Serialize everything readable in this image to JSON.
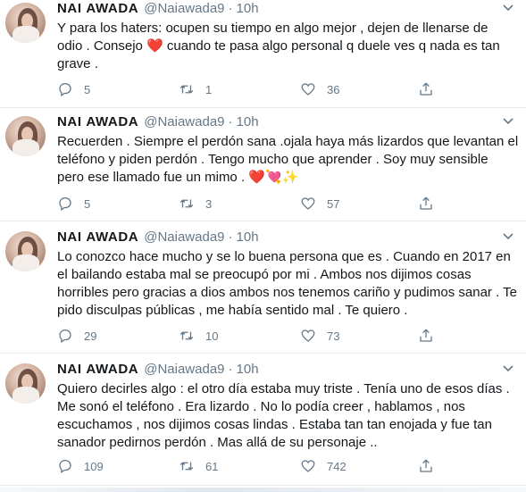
{
  "tweets": [
    {
      "name": "NΑΙ AWADA",
      "handle": "@Naiawada9",
      "time": "10h",
      "lines": [
        "Y para los haters: ocupen su tiempo en algo mejor , dejen de llenarse de",
        "odio . Consejo ❤️ cuando te pasa algo personal q duele ves q nada es tan",
        "grave ."
      ],
      "replies": "5",
      "retweets": "1",
      "likes": "36"
    },
    {
      "name": "NΑΙ AWADA",
      "handle": "@Naiawada9",
      "time": "10h",
      "lines": [
        "Recuerden . Siempre el perdón sana .ojala haya más lizardos que levantan el",
        "teléfono y piden perdón . Tengo mucho que aprender . Soy muy sensible",
        "pero ese llamado fue un mimo . ❤️💘✨"
      ],
      "replies": "5",
      "retweets": "3",
      "likes": "57"
    },
    {
      "name": "NΑΙ AWADA",
      "handle": "@Naiawada9",
      "time": "10h",
      "lines": [
        "Lo conozco hace mucho y se lo buena persona que es . Cuando en 2017 en",
        "el bailando estaba mal se preocupó por mi . Ambos nos dijimos cosas",
        "horribles pero gracias a dios ambos nos tenemos cariño y pudimos sanar . Te",
        "pido disculpas públicas , me había sentido mal . Te quiero ."
      ],
      "replies": "29",
      "retweets": "10",
      "likes": "73"
    },
    {
      "name": "NΑΙ AWADA",
      "handle": "@Naiawada9",
      "time": "10h",
      "lines": [
        "Quiero decirles algo : el otro día estaba muy triste . Tenía uno de esos días .",
        "Me sonó el teléfono . Era lizardo . No lo podía creer , hablamos , nos",
        "escuchamos , nos dijimos cosas lindas . Estaba tan tan enojada y fue tan",
        "sanador pedirnos perdón . Mas allá de su personaje .."
      ],
      "replies": "109",
      "retweets": "61",
      "likes": "742"
    }
  ],
  "colors": {
    "text": "#14171a",
    "muted": "#657786",
    "border": "#e6ecf0"
  },
  "icons": [
    "chevron-down-icon",
    "reply-icon",
    "retweet-icon",
    "like-icon",
    "share-icon"
  ]
}
